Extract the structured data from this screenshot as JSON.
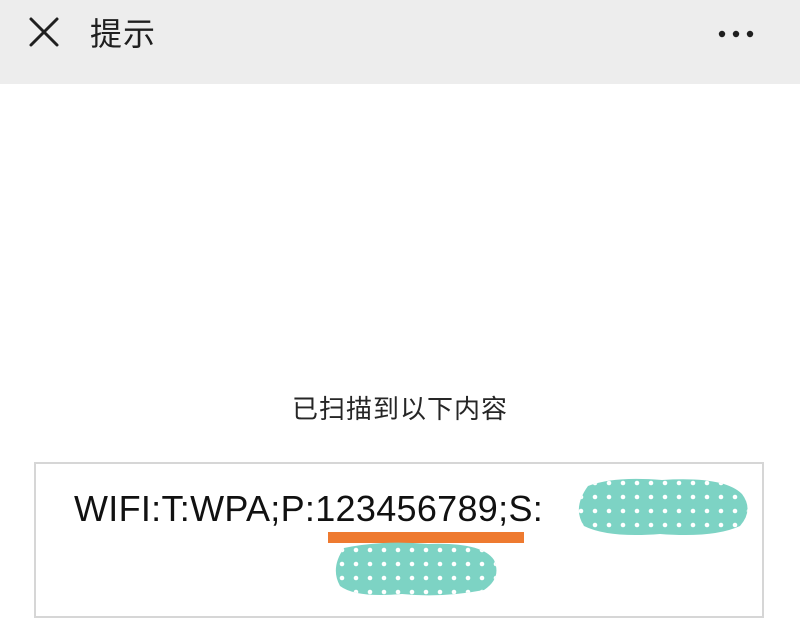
{
  "header": {
    "title": "提示",
    "close_icon": "close-icon",
    "more_icon": "more-icon",
    "background_color": "#ededed"
  },
  "main": {
    "scan_message": "已扫描到以下内容",
    "scanned_text": {
      "prefix": "WIFI:T:WPA;P:",
      "password": "123456789",
      "suffix": ";S:"
    },
    "highlight_color": "#ee7a30",
    "redaction_color": "#7dd3c4"
  }
}
